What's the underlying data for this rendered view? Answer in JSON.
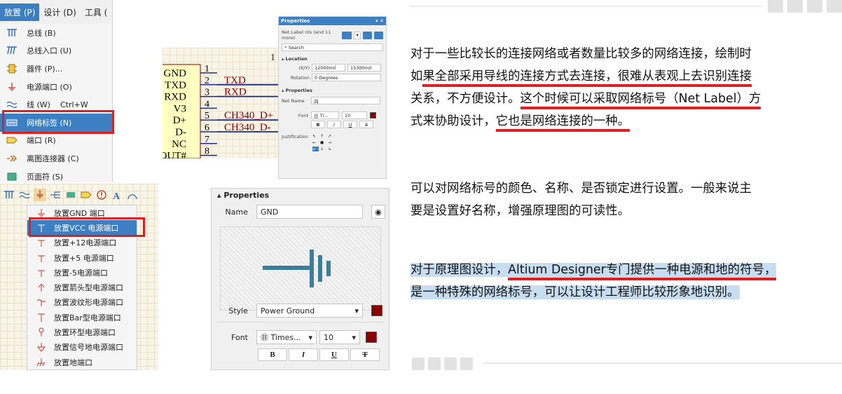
{
  "menu": {
    "bar": [
      {
        "label": "放置 (P)",
        "active": true
      },
      {
        "label": "设计 (D)",
        "active": false
      },
      {
        "label": "工具 (",
        "active": false
      }
    ],
    "items": [
      {
        "icon": "bus-icon",
        "label": "总线 (B)",
        "shortcut": ""
      },
      {
        "icon": "bus-entry-icon",
        "label": "总线入口 (U)",
        "shortcut": ""
      },
      {
        "icon": "part-icon",
        "label": "器件 (P)...",
        "shortcut": ""
      },
      {
        "icon": "power-port-icon",
        "label": "电源端口 (O)",
        "shortcut": ""
      },
      {
        "icon": "wire-icon",
        "label": "线 (W)",
        "shortcut": "Ctrl+W"
      },
      {
        "icon": "net-label-icon",
        "label": "网络标签 (N)",
        "shortcut": ""
      },
      {
        "icon": "port-icon",
        "label": "端口 (R)",
        "shortcut": ""
      },
      {
        "icon": "off-sheet-connector-icon",
        "label": "离图连接器 (C)",
        "shortcut": ""
      },
      {
        "icon": "page-number-icon",
        "label": "页面符 (S)",
        "shortcut": ""
      }
    ]
  },
  "power_list": [
    {
      "label": "放置GND 端口"
    },
    {
      "label": "放置VCC 电源端口"
    },
    {
      "label": "放置+12电源端口"
    },
    {
      "label": "放置+5 电源端口"
    },
    {
      "label": "放置-5电源端口"
    },
    {
      "label": "放置箭头型电源端口"
    },
    {
      "label": "放置波纹形电源端口"
    },
    {
      "label": "放置Bar型电源端口"
    },
    {
      "label": "放置环型电源端口"
    },
    {
      "label": "放置信号地电源端口"
    },
    {
      "label": "放置地端口"
    }
  ],
  "schematic": {
    "pins": [
      {
        "name": "GND",
        "num": "1",
        "net": ""
      },
      {
        "name": "TXD",
        "num": "2",
        "net": "TXD"
      },
      {
        "name": "RXD",
        "num": "3",
        "net": "RXD"
      },
      {
        "name": "V3",
        "num": "4",
        "net": ""
      },
      {
        "name": "D+",
        "num": "5",
        "net": "CH340_D+"
      },
      {
        "name": "D-",
        "num": "6",
        "net": "CH340_D-"
      },
      {
        "name": "NC",
        "num": "7",
        "net": ""
      },
      {
        "name": "OUT#",
        "num": "8",
        "net": ""
      }
    ]
  },
  "props_small": {
    "title": "Properties",
    "filter": "Net Label  nts (and 11 more)",
    "search": "Search",
    "location_header": "Location",
    "xy_label": "(X/Y)",
    "x_value": "12000mil",
    "y_value": "15300mil",
    "rotation_label": "Rotation",
    "rotation_value": "0 Degrees",
    "properties_header": "Properties",
    "net_name_label": "Net Name",
    "net_name_value": "间",
    "font_label": "Font",
    "font_value": "Ti...",
    "font_size": "10",
    "justification_label": "Justification"
  },
  "props_large": {
    "header": "Properties",
    "name_label": "Name",
    "name_value": "GND",
    "style_label": "Style",
    "style_value": "Power Ground",
    "font_label": "Font",
    "font_value": "Times...",
    "font_size": "10",
    "format": [
      "B",
      "I",
      "U",
      "T"
    ]
  },
  "text": {
    "p1": [
      "对于一些比较长的连接网络或者数量比较多的网络连接，绘制时",
      [
        "如",
        "果全部采用导线的连接方式去连接，很难从表观上去识别连接"
      ],
      [
        "关系，不方便设计。",
        "这个时候可以采取网络标号（Net Label）方"
      ],
      [
        "式来协助设计，",
        "它也是网络连接的一种。"
      ]
    ],
    "p2": [
      "可以对网络标号的颜色、名称、是否锁定进行设置。一般来说主",
      "要是设置好名称，增强原理图的可读性。"
    ],
    "p3": [
      [
        "对于原理图设计，",
        "Altium Designer专门提供一种电源和地的符号，"
      ],
      "是一种特殊的网络标号，可以让设计工程师比较形象地识别。"
    ]
  },
  "colors": {
    "accent": "#3c7fc3",
    "highlight_box": "#e02020",
    "net_label": "#8b0000",
    "text_highlight": "#c6ddf2"
  }
}
